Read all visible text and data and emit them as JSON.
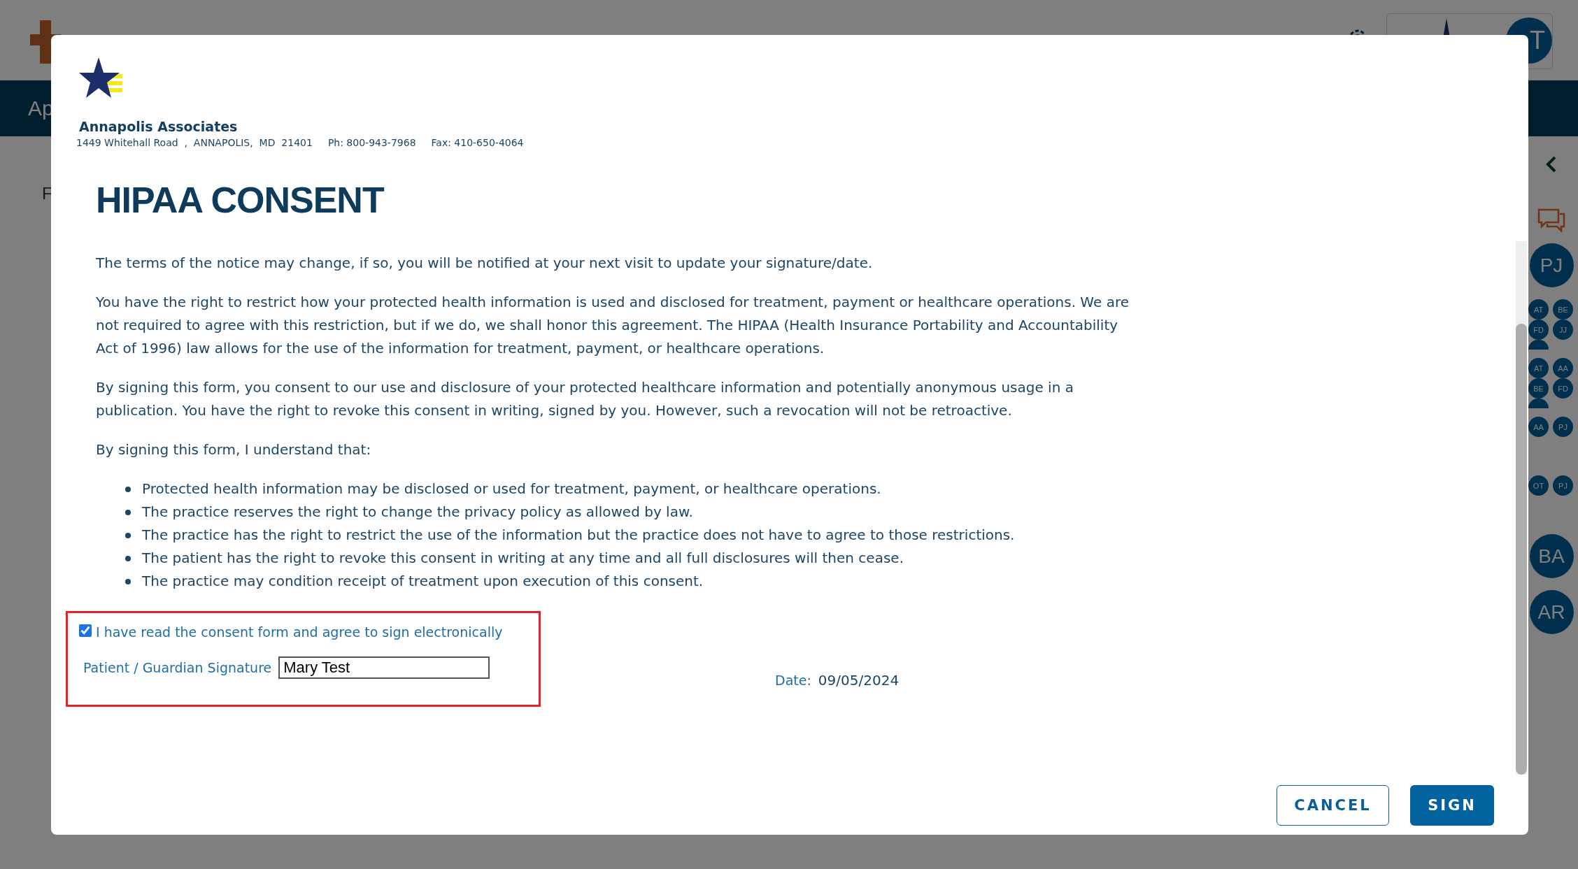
{
  "background": {
    "nav_label": "Ap",
    "content_label": "F",
    "user_avatar": "T",
    "side_panel": {
      "avatar_groups": [
        {
          "kind": "large",
          "initials": [
            "PJ"
          ],
          "cut": false
        },
        {
          "kind": "grid",
          "initials": [
            "AT",
            "BE",
            "FD",
            "JJ"
          ],
          "cut": true
        },
        {
          "kind": "grid",
          "initials": [
            "AT",
            "AA",
            "BE",
            "FD"
          ],
          "cut": true
        },
        {
          "kind": "grid",
          "initials": [
            "AA",
            "PJ"
          ],
          "cut": false
        },
        {
          "kind": "grid",
          "initials": [
            "OT",
            "PJ"
          ],
          "cut": false
        },
        {
          "kind": "large",
          "initials": [
            "BA"
          ],
          "cut": false
        },
        {
          "kind": "large",
          "initials": [
            "AR"
          ],
          "cut": false
        }
      ]
    }
  },
  "modal": {
    "practice": {
      "name": "Annapolis Associates",
      "address": "1449 Whitehall Road  ,  ANNAPOLIS,  MD  21401",
      "phone": "Ph: 800-943-7968",
      "fax": "Fax: 410-650-4064"
    },
    "title": "HIPAA CONSENT",
    "paragraphs": [
      "The terms of the notice may change, if so, you will be notified at your next visit to update your signature/date.",
      "You have the right to restrict how your protected health information is used and disclosed for treatment, payment or healthcare operations. We are not required to agree with this restriction, but if we do, we shall honor this agreement. The HIPAA (Health Insurance Portability and Accountability Act of 1996) law allows for the use of the information for treatment, payment, or healthcare operations.",
      "By signing this form, you consent to our use and disclosure of your protected healthcare information and potentially anonymous usage in a publication. You have the right to revoke this consent in writing, signed by you. However, such a revocation will not be retroactive.",
      "By signing this form, I understand that:"
    ],
    "bullets": [
      "Protected health information may be disclosed or used for treatment, payment, or healthcare operations.",
      "The practice reserves the right to change the privacy policy as allowed by law.",
      "The practice has the right to restrict the use of the information but the practice does not have to agree to those restrictions.",
      "The patient has the right to revoke this consent in writing at any time and all full disclosures will then cease.",
      "The practice may condition receipt of treatment upon execution of this consent."
    ],
    "consent": {
      "label": "I have read the consent form and agree to sign electronically",
      "checked": true,
      "highlighted": true
    },
    "signature": {
      "label": "Patient / Guardian Signature",
      "value": "Mary Test"
    },
    "date": {
      "label": "Date:",
      "value": "09/05/2024"
    },
    "buttons": [
      {
        "label": "CANCEL",
        "kind": "secondary"
      },
      {
        "label": "SIGN",
        "kind": "primary"
      }
    ]
  }
}
